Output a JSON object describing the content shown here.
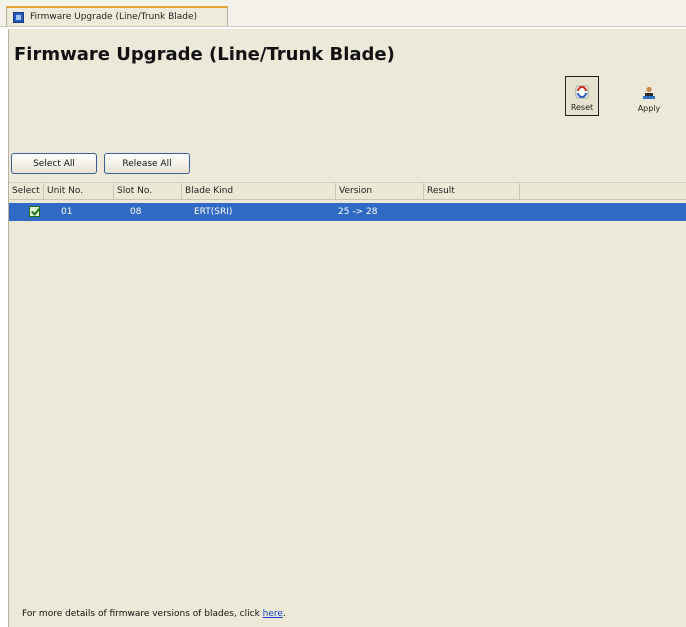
{
  "tab": {
    "label": "Firmware Upgrade (Line/Trunk Blade)"
  },
  "header": {
    "title": "Firmware Upgrade (Line/Trunk Blade)"
  },
  "toolbar": {
    "reset_label": "Reset",
    "apply_label": "Apply"
  },
  "actions": {
    "select_all_label": "Select All",
    "release_all_label": "Release All"
  },
  "table": {
    "columns": [
      "Select",
      "Unit No.",
      "Slot No.",
      "Blade Kind",
      "Version",
      "Result"
    ],
    "rows": [
      {
        "selected": true,
        "unit_no": "01",
        "slot_no": "08",
        "blade_kind": "ERT(SRI)",
        "version": "25 -> 28",
        "result": ""
      }
    ]
  },
  "footer": {
    "text": "For more details of firmware versions of blades, click",
    "link_label": "here",
    "trailing": "."
  },
  "colors": {
    "selection": "#316ac5",
    "panel": "#ece9d8",
    "tab_accent": "#e5a635",
    "link": "#1a3fd6"
  },
  "icons": {
    "reset": "reset-arrows-icon",
    "apply": "apply-person-icon",
    "tab": "app-window-icon"
  }
}
